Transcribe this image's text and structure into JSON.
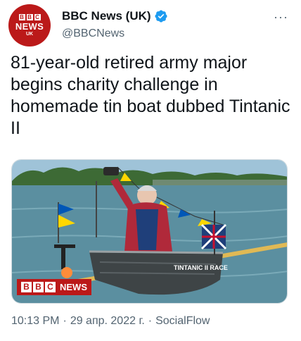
{
  "author": {
    "avatar": {
      "bbc_letters": [
        "B",
        "B",
        "C"
      ],
      "news": "NEWS",
      "region": "UK"
    },
    "display_name": "BBC News (UK)",
    "handle": "@BBCNews",
    "verified_color": "#1d9bf0"
  },
  "more_icon": "···",
  "tweet": {
    "text": "81-year-old retired army major begins charity challenge in homemade tin boat dubbed Tintanic II"
  },
  "media": {
    "boat_label": "TINTANIC II   RACE",
    "logo": {
      "letters": [
        "B",
        "B",
        "C"
      ],
      "news": "NEWS"
    }
  },
  "meta": {
    "time": "10:13 PM",
    "separator1": "·",
    "date": "29 апр. 2022 г.",
    "separator2": "·",
    "source": "SocialFlow"
  },
  "colors": {
    "brand_red": "#bb1919",
    "secondary_text": "#536471",
    "water": "#5b8fa0"
  }
}
